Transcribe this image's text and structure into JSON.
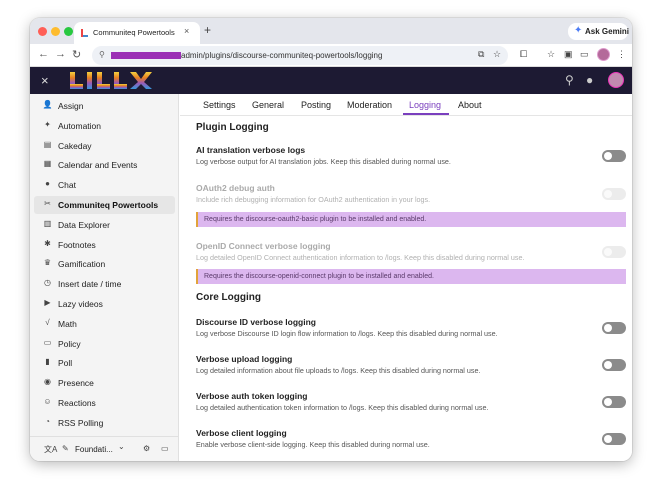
{
  "browser": {
    "tab_title": "Communiteq Powertools - Pl",
    "tab_close": "×",
    "new_tab": "+",
    "gemini_label": "Ask Gemini",
    "url": "admin/plugins/discourse-communiteq-powertools/logging"
  },
  "header": {
    "close": "×"
  },
  "sidebar": {
    "items": [
      {
        "label": "Assign",
        "icon": "user-plus-icon",
        "glyph": "👤"
      },
      {
        "label": "Automation",
        "icon": "wand-icon",
        "glyph": "✦"
      },
      {
        "label": "Cakeday",
        "icon": "cake-icon",
        "glyph": "▤"
      },
      {
        "label": "Calendar and Events",
        "icon": "calendar-icon",
        "glyph": "▦"
      },
      {
        "label": "Chat",
        "icon": "chat-icon",
        "glyph": "●"
      },
      {
        "label": "Communiteq Powertools",
        "icon": "tools-icon",
        "glyph": "✂"
      },
      {
        "label": "Data Explorer",
        "icon": "database-icon",
        "glyph": "▥"
      },
      {
        "label": "Footnotes",
        "icon": "asterisk-icon",
        "glyph": "✱"
      },
      {
        "label": "Gamification",
        "icon": "trophy-icon",
        "glyph": "♛"
      },
      {
        "label": "Insert date / time",
        "icon": "clock-icon",
        "glyph": "◷"
      },
      {
        "label": "Lazy videos",
        "icon": "play-icon",
        "glyph": "▶"
      },
      {
        "label": "Math",
        "icon": "square-root-icon",
        "glyph": "√"
      },
      {
        "label": "Policy",
        "icon": "file-icon",
        "glyph": "▭"
      },
      {
        "label": "Poll",
        "icon": "bar-chart-icon",
        "glyph": "▮"
      },
      {
        "label": "Presence",
        "icon": "eye-icon",
        "glyph": "◉"
      },
      {
        "label": "Reactions",
        "icon": "people-icon",
        "glyph": "☺"
      },
      {
        "label": "RSS Polling",
        "icon": "rss-icon",
        "glyph": "◔"
      }
    ],
    "active_index": 5,
    "footer": {
      "translate_icon": "文A",
      "theme_label": "Foundati...",
      "chevron": "⌄"
    }
  },
  "main": {
    "tabs": [
      "Settings",
      "General",
      "Posting",
      "Moderation",
      "Logging",
      "About"
    ],
    "active_tab": "Logging",
    "sections": {
      "plugin_logging": "Plugin Logging",
      "core_logging": "Core Logging"
    },
    "settings": {
      "ai_translation": {
        "title": "AI translation verbose logs",
        "desc": "Log verbose output for AI translation jobs. Keep this disabled during normal use."
      },
      "oauth2": {
        "title": "OAuth2 debug auth",
        "desc": "Include rich debugging information for OAuth2 authentication in your logs.",
        "notice": "Requires the discourse-oauth2-basic plugin to be installed and enabled."
      },
      "openid": {
        "title": "OpenID Connect verbose logging",
        "desc": "Log detailed OpenID Connect authentication information to /logs. Keep this disabled during normal use.",
        "notice": "Requires the discourse-openid-connect plugin to be installed and enabled."
      },
      "discourse_id": {
        "title": "Discourse ID verbose logging",
        "desc": "Log verbose Discourse ID login flow information to /logs. Keep this disabled during normal use."
      },
      "upload": {
        "title": "Verbose upload logging",
        "desc": "Log detailed information about file uploads to /logs. Keep this disabled during normal use."
      },
      "auth_token": {
        "title": "Verbose auth token logging",
        "desc": "Log detailed authentication token information to /logs. Keep this disabled during normal use."
      },
      "client": {
        "title": "Verbose client logging",
        "desc": "Enable verbose client-side logging. Keep this disabled during normal use."
      }
    }
  },
  "colors": {
    "accent": "#7a3fbe",
    "header_bg": "#1d1a33",
    "notice_bg": "#dcb7ef",
    "notice_border": "#e2a33a",
    "toggle_off": "#8b8b8b"
  }
}
